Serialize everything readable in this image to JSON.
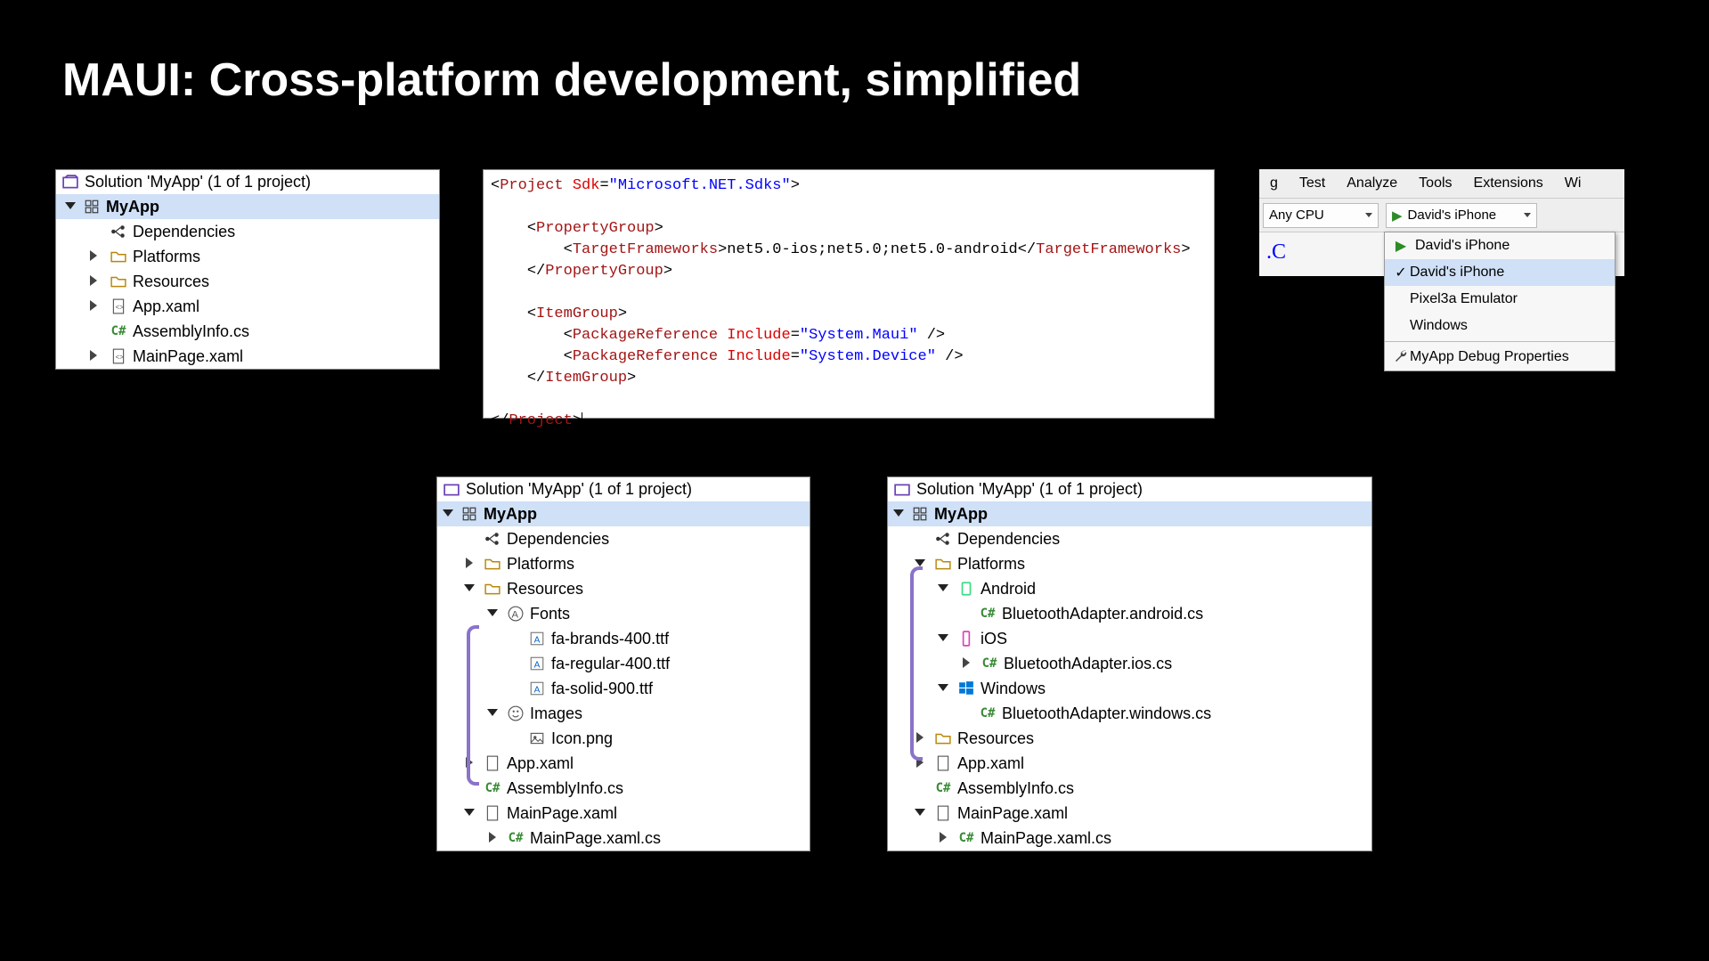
{
  "title": "MAUI: Cross-platform development, simplified",
  "solution": {
    "header": "Solution 'MyApp' (1 of 1 project)",
    "project": "MyApp",
    "deps": "Dependencies",
    "platforms": "Platforms",
    "resources": "Resources",
    "app_xaml": "App.xaml",
    "assembly": "AssemblyInfo.cs",
    "mainpage": "MainPage.xaml",
    "mainpage_cs": "MainPage.xaml.cs",
    "fonts": "Fonts",
    "images": "Images",
    "icon_png": "Icon.png",
    "font_files": [
      "fa-brands-400.ttf",
      "fa-regular-400.ttf",
      "fa-solid-900.ttf"
    ],
    "android": "Android",
    "ios": "iOS",
    "windows": "Windows",
    "bt_android": "BluetoothAdapter.android.cs",
    "bt_ios": "BluetoothAdapter.ios.cs",
    "bt_windows": "BluetoothAdapter.windows.cs"
  },
  "code": {
    "sdk": "Microsoft.NET.Sdks",
    "tfm": "net5.0-ios;net5.0;net5.0-android",
    "pkg1": "System.Maui",
    "pkg2": "System.Device"
  },
  "toolbar": {
    "menu": [
      "g",
      "Test",
      "Analyze",
      "Tools",
      "Extensions",
      "Wi"
    ],
    "cpu": "Any CPU",
    "target": "David's iPhone",
    "dropdown": [
      {
        "label": "David's iPhone",
        "checked": false,
        "play": true
      },
      {
        "label": "David's iPhone",
        "checked": true,
        "play": false
      },
      {
        "label": "Pixel3a Emulator",
        "checked": false,
        "play": false
      },
      {
        "label": "Windows",
        "checked": false,
        "play": false
      }
    ],
    "debug_props": "MyApp Debug Properties"
  }
}
